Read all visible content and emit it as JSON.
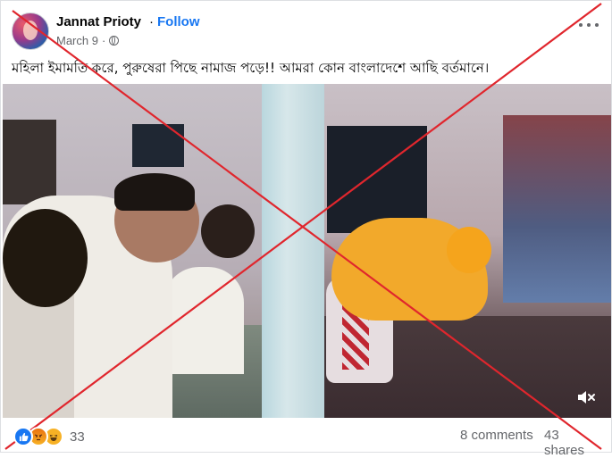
{
  "post": {
    "author": "Jannat Prioty",
    "follow_label": "Follow",
    "separator": "·",
    "date": "March 9",
    "meta_dot": "·",
    "caption": "মহিলা ইমামতি করে, পুরুষেরা পিছে নামাজ পড়ে!! আমরা কোন বাংলাদেশে আছি বর্তমানে।"
  },
  "video": {
    "mute_icon": "volume-muted-icon"
  },
  "overlay": {
    "mark": "red-x-cross",
    "color": "#e0262d"
  },
  "footer": {
    "reaction_icons": [
      "like-reaction-icon",
      "angry-reaction-icon",
      "haha-reaction-icon"
    ],
    "reaction_count": "33",
    "comments": "8 comments",
    "shares": "43 shares"
  },
  "colors": {
    "link": "#1877f2",
    "secondary_text": "#65676b"
  }
}
